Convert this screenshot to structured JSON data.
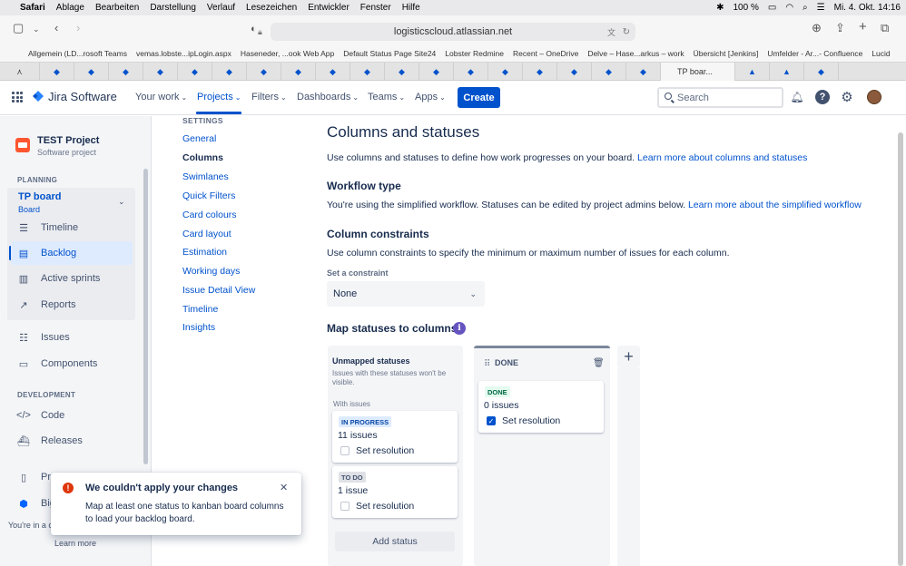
{
  "menubar": {
    "app": "Safari",
    "items": [
      "Ablage",
      "Bearbeiten",
      "Darstellung",
      "Verlauf",
      "Lesezeichen",
      "Entwickler",
      "Fenster",
      "Hilfe"
    ],
    "battery": "100 %",
    "datetime": "Mi. 4. Okt.  14:16"
  },
  "browser": {
    "url": "logisticscloud.atlassian.net",
    "bookmarks": [
      "Allgemein (LD...rosoft Teams",
      "vemas.lobste...ipLogin.aspx",
      "Haseneder, ...ook Web App",
      "Default Status Page Site24",
      "Lobster Redmine",
      "Recent – OneDrive",
      "Delve – Hase...arkus – work",
      "Übersicht [Jenkins]",
      "Umfelder - Ar...- Confluence",
      "Lucid"
    ],
    "active_tab": "TP boar..."
  },
  "topnav": {
    "product": "Jira Software",
    "items": [
      "Your work",
      "Projects",
      "Filters",
      "Dashboards",
      "Teams",
      "Apps"
    ],
    "create": "Create",
    "search_placeholder": "Search"
  },
  "sidebar": {
    "project_name": "TEST Project",
    "project_type": "Software project",
    "planning_head": "PLANNING",
    "board_name": "TP board",
    "board_sub": "Board",
    "planning_items": [
      "Timeline",
      "Backlog",
      "Active sprints",
      "Reports"
    ],
    "other_items": [
      "Issues",
      "Components"
    ],
    "development_head": "DEVELOPMENT",
    "dev_items": [
      "Code",
      "Releases"
    ],
    "bottom_items": [
      "Pro",
      "Big"
    ],
    "footer_text": "You're in a c",
    "learn_more": "Learn more"
  },
  "settings_nav": {
    "head": "SETTINGS",
    "items": [
      "General",
      "Columns",
      "Swimlanes",
      "Quick Filters",
      "Card colours",
      "Card layout",
      "Estimation",
      "Working days",
      "Issue Detail View",
      "Timeline",
      "Insights"
    ]
  },
  "main": {
    "title": "Columns and statuses",
    "intro": "Use columns and statuses to define how work progresses on your board.",
    "intro_link": "Learn more about columns and statuses",
    "workflow_head": "Workflow type",
    "workflow_text": "You're using the simplified workflow. Statuses can be edited by project admins below.",
    "workflow_link": "Learn more about the simplified workflow",
    "constraints_head": "Column constraints",
    "constraints_text": "Use column constraints to specify the minimum or maximum number of issues for each column.",
    "constraint_label": "Set a constraint",
    "constraint_value": "None",
    "map_head": "Map statuses to columns"
  },
  "unmapped": {
    "title": "Unmapped statuses",
    "note": "Issues with these statuses won't be visible.",
    "with_issues": "With issues",
    "cards": [
      {
        "status": "IN PROGRESS",
        "count": "11 issues",
        "resolution": "Set resolution"
      },
      {
        "status": "TO DO",
        "count": "1 issue",
        "resolution": "Set resolution"
      }
    ],
    "add_status": "Add status"
  },
  "done_column": {
    "title": "DONE",
    "card": {
      "status": "DONE",
      "count": "0 issues",
      "resolution": "Set resolution"
    }
  },
  "flag": {
    "title": "We couldn't apply your changes",
    "body": "Map at least one status to kanban board columns to load your backlog board."
  }
}
